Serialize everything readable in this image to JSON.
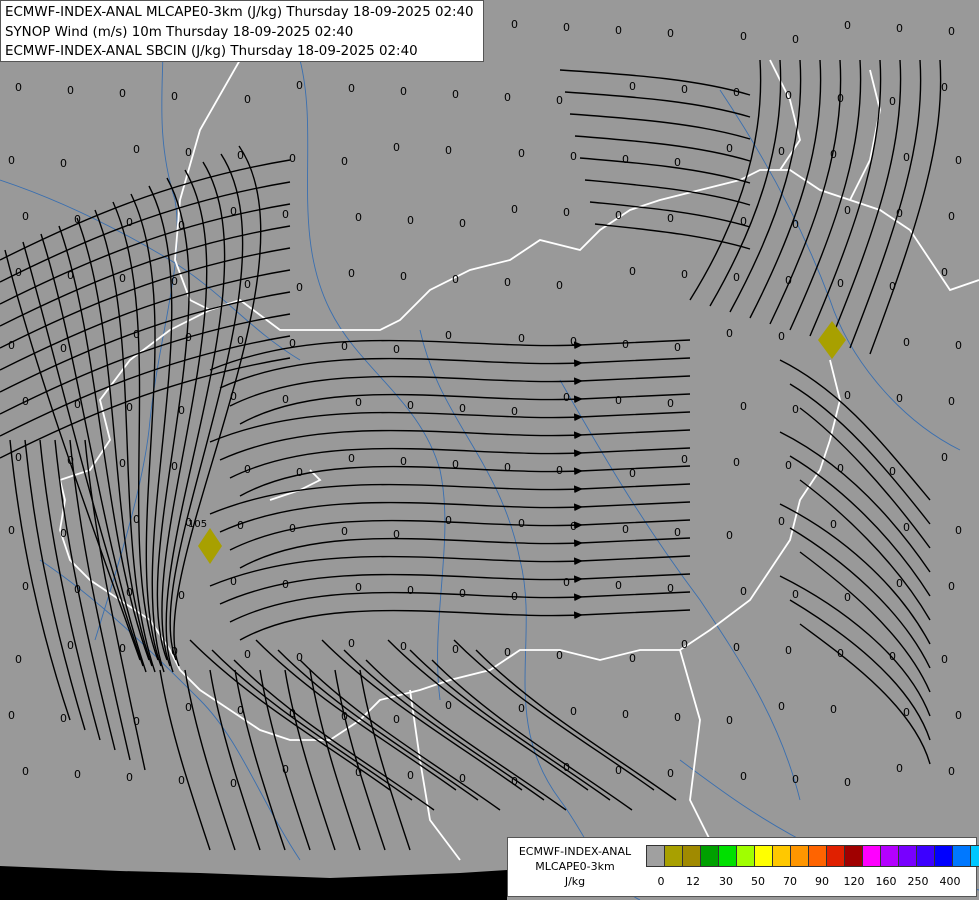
{
  "titles": [
    "ECMWF-INDEX-ANAL MLCAPE0-3km (J/kg) Thursday 18-09-2025 02:40",
    "SYNOP Wind (m/s) 10m Thursday 18-09-2025 02:40",
    "ECMWF-INDEX-ANAL SBCIN (J/kg) Thursday 18-09-2025 02:40"
  ],
  "colors": {
    "background": "#999999",
    "border": "#ffffff",
    "river": "#3a6fb0",
    "streamline": "#000000",
    "marker": "#a8a000"
  },
  "station_value": "0",
  "cape_label": "105",
  "legend": {
    "line1": "ECMWF-INDEX-ANAL",
    "line2": "MLCAPE0-3km",
    "line3": "J/kg",
    "swatches": [
      "#a0a0a0",
      "#a8a000",
      "#a08a00",
      "#00a000",
      "#00e000",
      "#a0ff00",
      "#ffff00",
      "#ffc800",
      "#ff9600",
      "#ff6400",
      "#e02000",
      "#a00000",
      "#ff00ff",
      "#b400ff",
      "#7800ff",
      "#3c00ff",
      "#0000ff",
      "#0078ff",
      "#00c8ff",
      "#00ffff",
      "#ffffff"
    ],
    "ticks": [
      "0",
      "12",
      "30",
      "50",
      "70",
      "90",
      "120",
      "160",
      "250",
      "400"
    ]
  }
}
